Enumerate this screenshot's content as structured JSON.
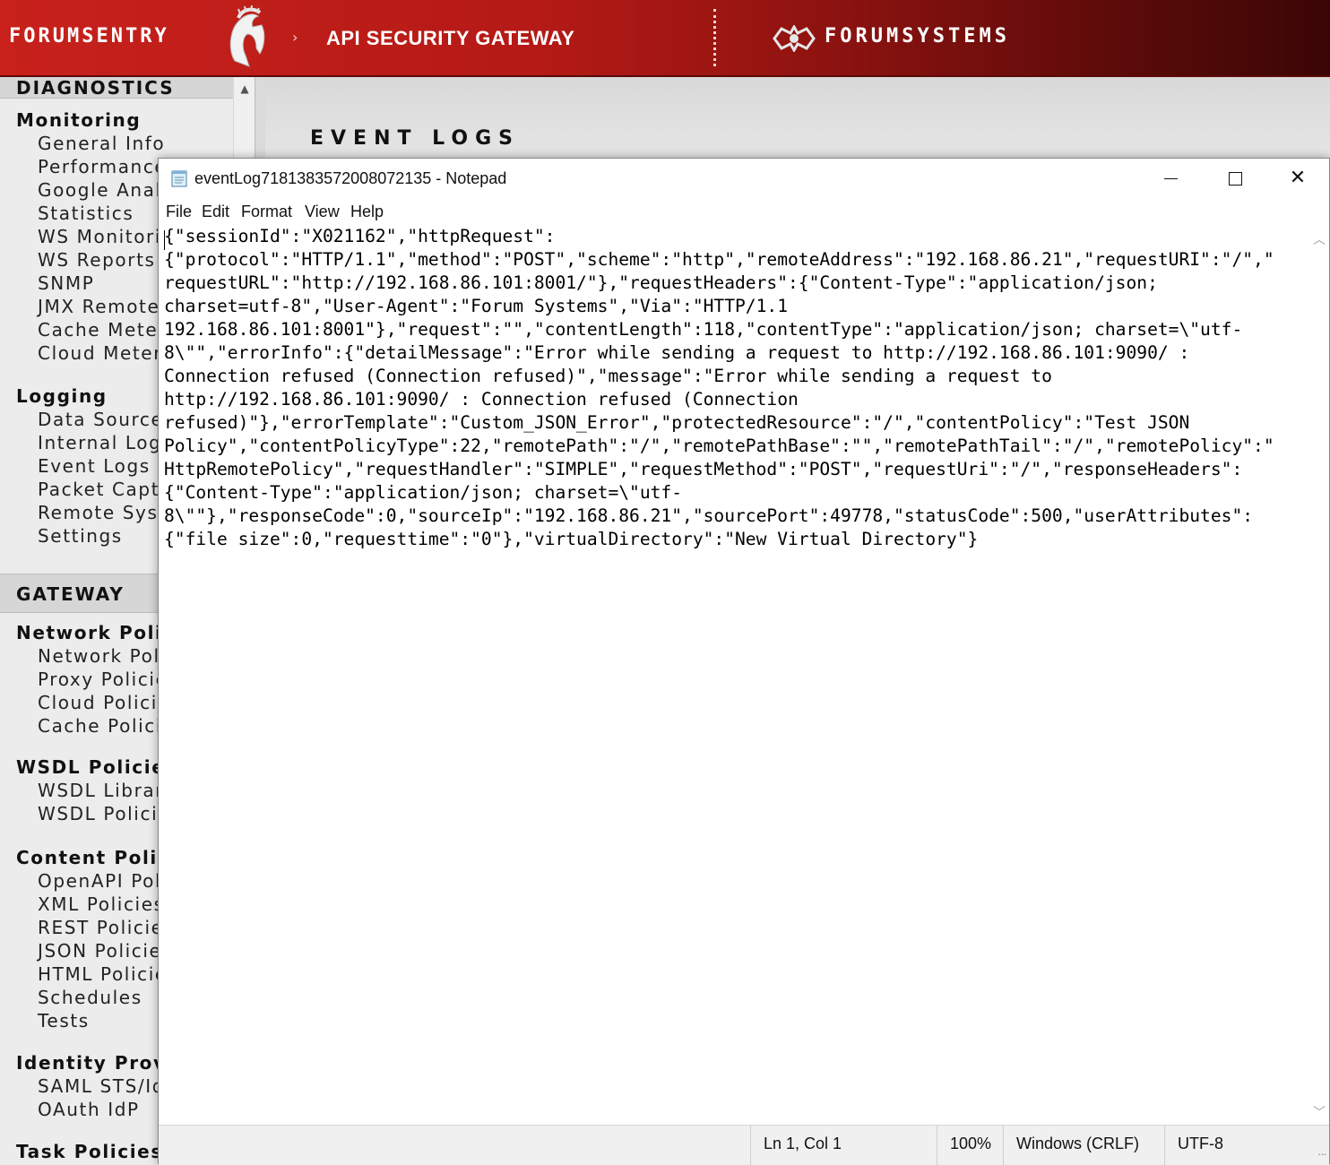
{
  "banner": {
    "brand_left": "FORUMSENTRY",
    "crumb_arrow": "›",
    "product": "API SECURITY GATEWAY",
    "brand_right": "FORUMSYSTEMS",
    "colors": {
      "banner_red": "#c8211c",
      "banner_dark": "#3a0605"
    }
  },
  "sidebar": {
    "top_section": "DIAGNOSTICS",
    "monitoring": {
      "label": "Monitoring",
      "items": [
        "General Info",
        "Performance",
        "Google Analy",
        "Statistics",
        "WS Monitorin",
        "WS Reports",
        "SNMP",
        "JMX Remote",
        "Cache Meter",
        "Cloud Meter"
      ]
    },
    "logging": {
      "label": "Logging",
      "items": [
        "Data Sources",
        "Internal Logs",
        "Event Logs",
        "Packet Captu",
        "Remote Syslo",
        "Settings"
      ]
    },
    "gateway_section": "GATEWAY",
    "network_policies": {
      "label": "Network Polici",
      "items": [
        "Network Polic",
        "Proxy Policie",
        "Cloud Policie",
        "Cache Policie"
      ]
    },
    "wsdl_policies": {
      "label": "WSDL Policies",
      "items": [
        "WSDL Librari",
        "WSDL Policie"
      ]
    },
    "content_policies": {
      "label": "Content Polici",
      "items": [
        "OpenAPI Pol",
        "XML Policies",
        "REST Policie",
        "JSON Policie",
        "HTML Policie",
        "Schedules",
        "Tests"
      ]
    },
    "identity_providers": {
      "label": "Identity Provid",
      "items": [
        "SAML STS/Id",
        "OAuth IdP"
      ]
    },
    "task_policies": {
      "label": "Task Policies"
    }
  },
  "main": {
    "title": "EVENT LOGS"
  },
  "notepad": {
    "title": "eventLog7181383572008072135 - Notepad",
    "menu": [
      "File",
      "Edit",
      "Format",
      "View",
      "Help"
    ],
    "lines": [
      "{\"sessionId\":\"X021162\",\"httpRequest\":",
      "{\"protocol\":\"HTTP/1.1\",\"method\":\"POST\",\"scheme\":\"http\",\"remoteAddress\":\"192.168.86.21\",\"requestURI\":\"/\",\"",
      "requestURL\":\"http://192.168.86.101:8001/\"},\"requestHeaders\":{\"Content-Type\":\"application/json;",
      "charset=utf-8\",\"User-Agent\":\"Forum Systems\",\"Via\":\"HTTP/1.1",
      "192.168.86.101:8001\"},\"request\":\"\",\"contentLength\":118,\"contentType\":\"application/json; charset=\\\"utf-",
      "8\\\"\",\"errorInfo\":{\"detailMessage\":\"Error while sending a request to http://192.168.86.101:9090/ :",
      "Connection refused (Connection refused)\",\"message\":\"Error while sending a request to",
      "http://192.168.86.101:9090/ : Connection refused (Connection",
      "refused)\"},\"errorTemplate\":\"Custom_JSON_Error\",\"protectedResource\":\"/\",\"contentPolicy\":\"Test JSON",
      "Policy\",\"contentPolicyType\":22,\"remotePath\":\"/\",\"remotePathBase\":\"\",\"remotePathTail\":\"/\",\"remotePolicy\":\"",
      "HttpRemotePolicy\",\"requestHandler\":\"SIMPLE\",\"requestMethod\":\"POST\",\"requestUri\":\"/\",\"responseHeaders\":",
      "{\"Content-Type\":\"application/json; charset=\\\"utf-",
      "8\\\"\"},\"responseCode\":0,\"sourceIp\":\"192.168.86.21\",\"sourcePort\":49778,\"statusCode\":500,\"userAttributes\":",
      "{\"file size\":0,\"requesttime\":\"0\"},\"virtualDirectory\":\"New Virtual Directory\"}"
    ],
    "status": {
      "position": "Ln 1, Col 1",
      "zoom": "100%",
      "line_endings": "Windows (CRLF)",
      "encoding": "UTF-8"
    },
    "icons": [
      "notepad-icon",
      "minimize-icon",
      "maximize-icon",
      "close-icon"
    ]
  }
}
